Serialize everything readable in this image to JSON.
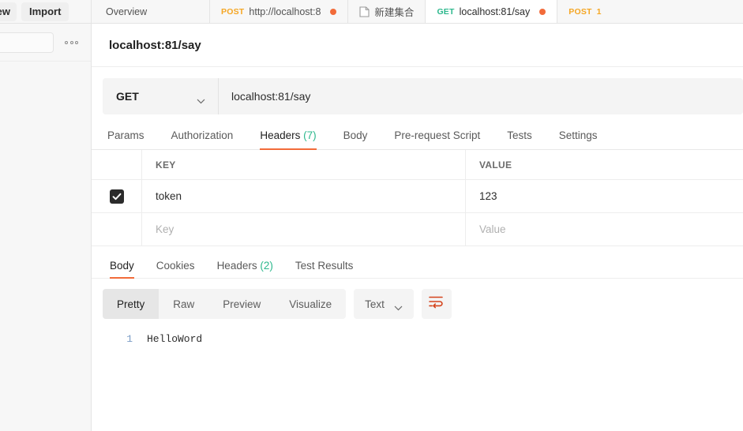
{
  "sidebar": {
    "new_button": "lew",
    "import_button": "Import",
    "search_placeholder": "",
    "more_icon": "ellipsis-icon"
  },
  "tabstrip": {
    "tabs": [
      {
        "label": "Overview",
        "method": "",
        "active": false,
        "unsaved": false,
        "icon": ""
      },
      {
        "label": "http://localhost:8",
        "method": "POST",
        "active": false,
        "unsaved": true,
        "icon": ""
      },
      {
        "label": "新建集合",
        "method": "",
        "active": false,
        "unsaved": false,
        "icon": "collection-icon"
      },
      {
        "label": "localhost:81/say",
        "method": "GET",
        "active": true,
        "unsaved": true,
        "icon": ""
      },
      {
        "label": "1",
        "method": "POST",
        "active": false,
        "unsaved": false,
        "icon": ""
      }
    ]
  },
  "request": {
    "title": "localhost:81/say",
    "method": "GET",
    "url": "localhost:81/say",
    "tabs": [
      {
        "label": "Params",
        "count": "",
        "active": false
      },
      {
        "label": "Authorization",
        "count": "",
        "active": false
      },
      {
        "label": "Headers",
        "count": "(7)",
        "active": true
      },
      {
        "label": "Body",
        "count": "",
        "active": false
      },
      {
        "label": "Pre-request Script",
        "count": "",
        "active": false
      },
      {
        "label": "Tests",
        "count": "",
        "active": false
      },
      {
        "label": "Settings",
        "count": "",
        "active": false
      }
    ],
    "headers_table": {
      "columns": [
        "KEY",
        "VALUE"
      ],
      "rows": [
        {
          "checked": true,
          "key": "token",
          "value": "123",
          "placeholder": false
        },
        {
          "checked": false,
          "key": "Key",
          "value": "Value",
          "placeholder": true
        }
      ]
    }
  },
  "response": {
    "tabs": [
      {
        "label": "Body",
        "count": "",
        "active": true
      },
      {
        "label": "Cookies",
        "count": "",
        "active": false
      },
      {
        "label": "Headers",
        "count": "(2)",
        "active": false
      },
      {
        "label": "Test Results",
        "count": "",
        "active": false
      }
    ],
    "format_modes": [
      {
        "label": "Pretty",
        "active": true
      },
      {
        "label": "Raw",
        "active": false
      },
      {
        "label": "Preview",
        "active": false
      },
      {
        "label": "Visualize",
        "active": false
      }
    ],
    "content_type": "Text",
    "wrap_icon": "word-wrap-icon",
    "body_lines": [
      {
        "num": "1",
        "text": "HelloWord"
      }
    ]
  },
  "colors": {
    "accent_orange": "#f26b3a",
    "method_get": "#2db88d",
    "method_post": "#f5a623",
    "panel_gray": "#f4f4f4"
  }
}
